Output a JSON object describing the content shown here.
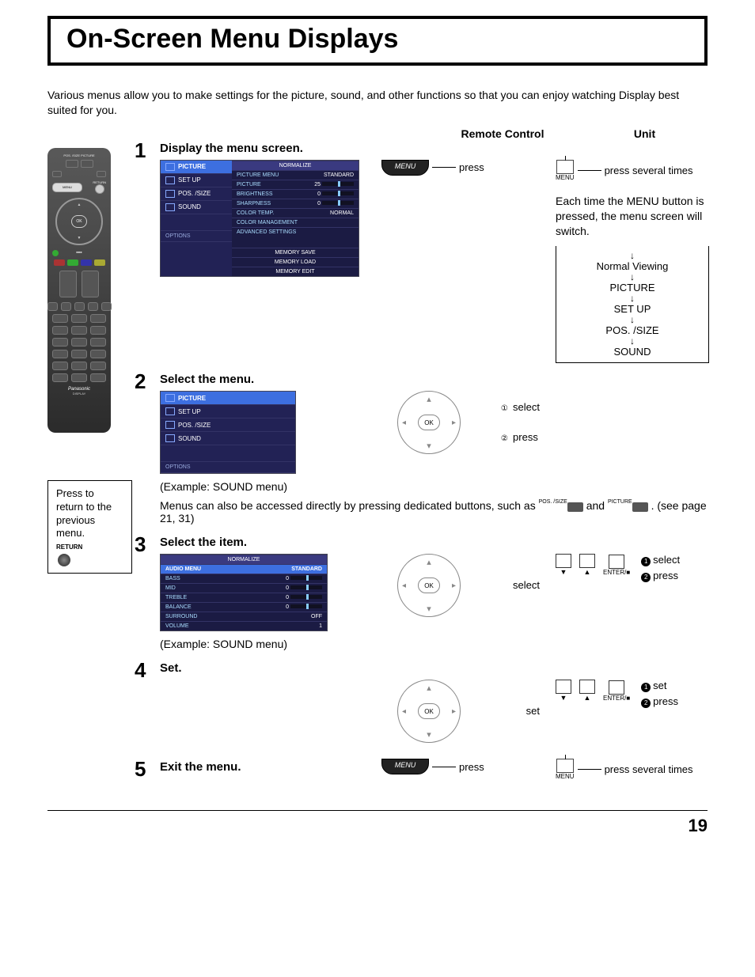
{
  "page_title": "On-Screen Menu Displays",
  "intro": "Various menus allow you to make settings for the picture, sound, and other functions so that you can enjoy watching Display best suited for you.",
  "columns": {
    "remote_control": "Remote Control",
    "unit": "Unit"
  },
  "remote": {
    "top_labels": "POS. /SIZE   PICTURE",
    "menu_label": "MENU",
    "return_label": "RETURN",
    "ok_label": "OK",
    "brand": "Panasonic",
    "sub": "DISPLAY"
  },
  "tip": {
    "text": "Press to return to the previous menu.",
    "return": "RETURN"
  },
  "steps": {
    "s1": {
      "num": "1",
      "heading": "Display the menu screen.",
      "rc_action": "press",
      "rc_btn": "MENU",
      "unit_action": "press several times",
      "unit_btn": "MENU",
      "unit_note": "Each time the MENU button is pressed, the menu screen will switch.",
      "flow": [
        "Normal Viewing",
        "PICTURE",
        "SET UP",
        "POS. /SIZE",
        "SOUND"
      ]
    },
    "s2": {
      "num": "2",
      "heading": "Select the menu.",
      "select": "select",
      "press": "press",
      "note_example": "(Example: SOUND menu)",
      "note_text1": "Menus can also be accessed directly by pressing dedicated buttons, such as ",
      "btn1_lbl": "POS. /SIZE",
      "and": " and ",
      "btn2_lbl": "PICTURE",
      "note_text2": ". (see page 21, 31)"
    },
    "s3": {
      "num": "3",
      "heading": "Select the item.",
      "select": "select",
      "press": "press",
      "note_example": "(Example: SOUND menu)",
      "unit_enter": "ENTER/■"
    },
    "s4": {
      "num": "4",
      "heading": "Set.",
      "set": "set",
      "press": "press",
      "unit_enter": "ENTER/■"
    },
    "s5": {
      "num": "5",
      "heading": "Exit the menu.",
      "rc_action": "press",
      "rc_btn": "MENU",
      "unit_action": "press several times",
      "unit_btn": "MENU"
    }
  },
  "osd": {
    "sidebar": [
      "PICTURE",
      "SET UP",
      "POS. /SIZE",
      "SOUND"
    ],
    "options": "OPTIONS",
    "picture_panel": {
      "normalize": "NORMALIZE",
      "rows": [
        [
          "PICTURE MENU",
          "STANDARD"
        ],
        [
          "PICTURE",
          "25"
        ],
        [
          "BRIGHTNESS",
          "0"
        ],
        [
          "SHARPNESS",
          "0"
        ],
        [
          "COLOR TEMP.",
          "NORMAL"
        ],
        [
          "COLOR MANAGEMENT",
          ""
        ],
        [
          "ADVANCED SETTINGS",
          ""
        ]
      ],
      "memory": [
        "MEMORY SAVE",
        "MEMORY LOAD",
        "MEMORY EDIT"
      ]
    },
    "sound_panel": {
      "normalize": "NORMALIZE",
      "rows": [
        [
          "AUDIO MENU",
          "STANDARD"
        ],
        [
          "BASS",
          "0"
        ],
        [
          "MID",
          "0"
        ],
        [
          "TREBLE",
          "0"
        ],
        [
          "BALANCE",
          "0"
        ],
        [
          "SURROUND",
          "OFF"
        ],
        [
          "VOLUME",
          "1"
        ]
      ]
    }
  },
  "dpad": {
    "ok": "OK"
  },
  "circled": {
    "one": "①",
    "two": "②",
    "dot1": "1",
    "dot2": "2"
  },
  "unit_arrows": {
    "down": "▼",
    "up": "▲"
  },
  "page_number": "19"
}
